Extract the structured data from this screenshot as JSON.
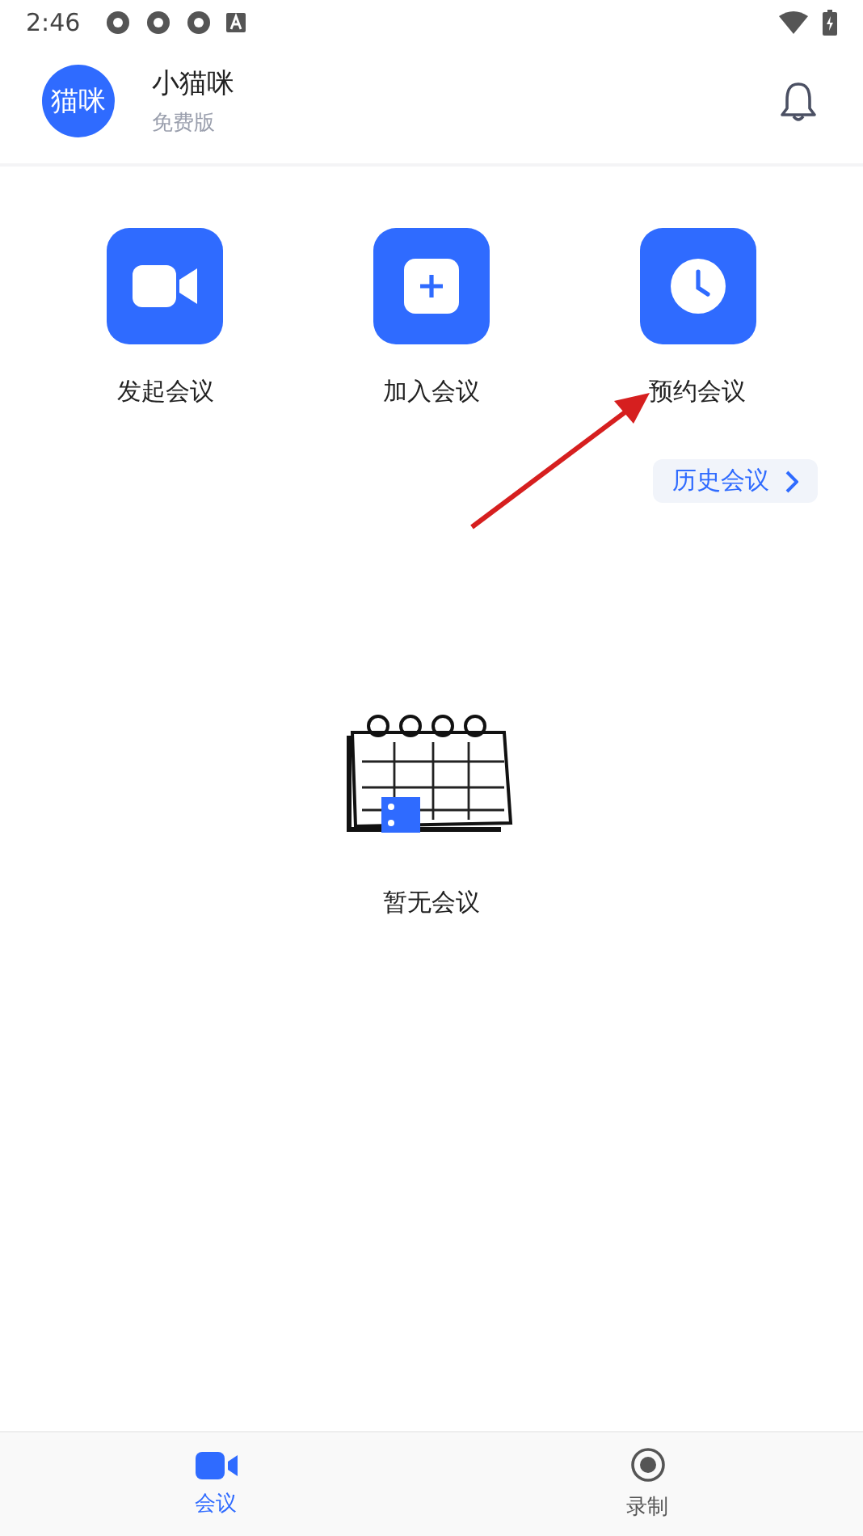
{
  "status_bar": {
    "time": "2:46"
  },
  "profile": {
    "avatar": "猫咪",
    "name": "小猫咪",
    "plan": "免费版"
  },
  "actions": [
    {
      "kind": "video",
      "label": "发起会议"
    },
    {
      "kind": "plus",
      "label": "加入会议"
    },
    {
      "kind": "clock",
      "label": "预约会议"
    }
  ],
  "history_button": {
    "label": "历史会议"
  },
  "empty_state": {
    "message": "暂无会议"
  },
  "tabs": [
    {
      "kind": "video",
      "label": "会议",
      "selected": true
    },
    {
      "kind": "record",
      "label": "录制",
      "selected": false
    }
  ]
}
